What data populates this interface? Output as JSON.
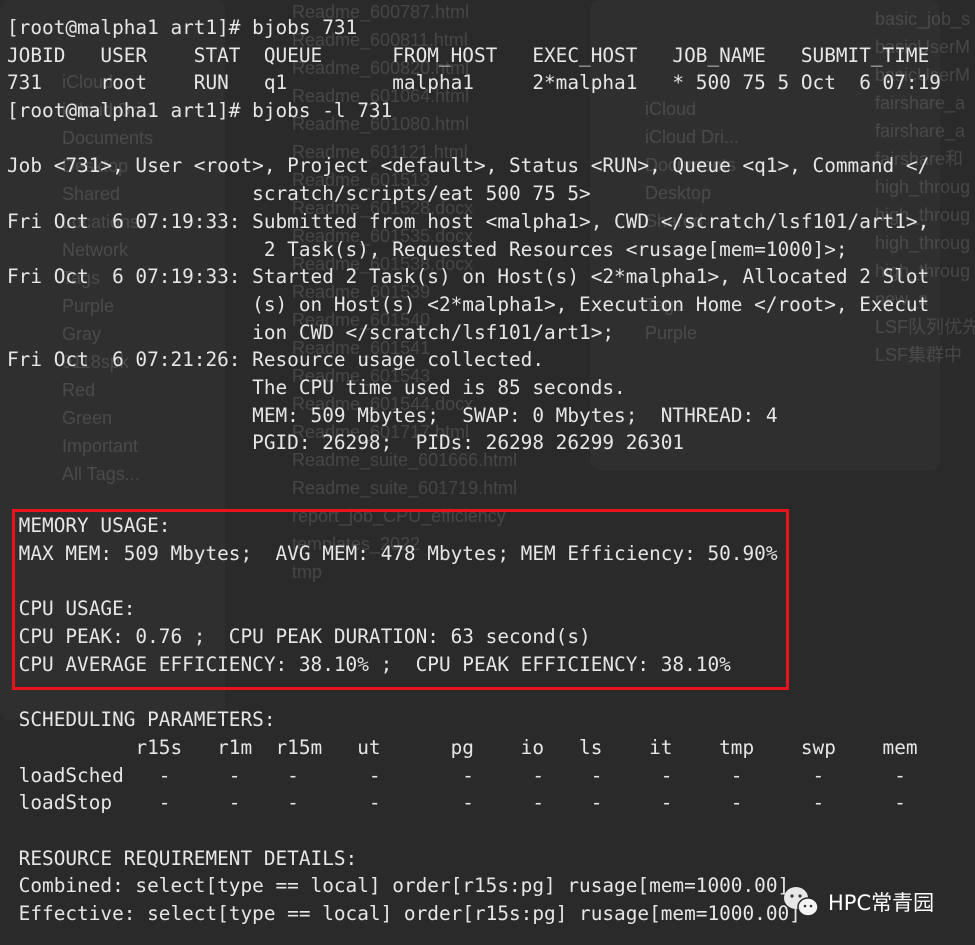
{
  "background": {
    "sidebar_items": [
      "iCloud",
      "iCloud Dri...",
      "Documents",
      "Desktop",
      "Shared",
      "Locations",
      "Network",
      "Tags",
      "Purple",
      "Gray",
      "9118spk",
      "Red",
      "Green",
      "Important",
      "All Tags..."
    ],
    "icloud_items": [
      "iCloud",
      "iCloud Dri...",
      "Documents",
      "Desktop",
      "Shared",
      "",
      "",
      "Tags",
      "Purple"
    ],
    "files_middle": [
      "Readme_600787.html",
      "Readme_600811.html",
      "Readme_600820.html",
      "Readme_601064.html",
      "Readme_601080.html",
      "Readme_601121.html",
      "Readme_601513",
      "Readme_601528.docx",
      "Readme_601535.docx",
      "Readme_601538.docx",
      "Readme_601539",
      "Readme_601540",
      "Readme_601541",
      "Readme_601543",
      "Readme_601544.docx",
      "Readme_601717.html",
      "Readme_suite_601666.html",
      "Readme_suite_601719.html",
      "report_job_CPU_efficiency",
      "templates_2022",
      "tmp"
    ],
    "files_right": [
      "basic_job_s",
      "basicUserM",
      "basicUserM",
      "fairshare_a",
      "fairshare_a",
      "fairshare和",
      "high_throug",
      "high_throug",
      "high_throug",
      "high_throug",
      "new_a",
      "LSF队列优先",
      "LSF集群中"
    ]
  },
  "terminal": {
    "lines": [
      "[root@malpha1 art1]# bjobs 731",
      "JOBID   USER    STAT  QUEUE      FROM_HOST   EXEC_HOST   JOB_NAME   SUBMIT_TIME",
      "731     root    RUN   q1         malpha1     2*malpha1   * 500 75 5 Oct  6 07:19",
      "[root@malpha1 art1]# bjobs -l 731",
      "",
      "Job <731>, User <root>, Project <default>, Status <RUN>, Queue <q1>, Command </",
      "                     scratch/scripts/eat 500 75 5>",
      "Fri Oct  6 07:19:33: Submitted from host <malpha1>, CWD </scratch/lsf101/art1>,",
      "                      2 Task(s), Requested Resources <rusage[mem=1000]>;",
      "Fri Oct  6 07:19:33: Started 2 Task(s) on Host(s) <2*malpha1>, Allocated 2 Slot",
      "                     (s) on Host(s) <2*malpha1>, Execution Home </root>, Execut",
      "                     ion CWD </scratch/lsf101/art1>;",
      "Fri Oct  6 07:21:26: Resource usage collected.",
      "                     The CPU time used is 85 seconds.",
      "                     MEM: 509 Mbytes;  SWAP: 0 Mbytes;  NTHREAD: 4",
      "                     PGID: 26298;  PIDs: 26298 26299 26301",
      "",
      "",
      " MEMORY USAGE:",
      " MAX MEM: 509 Mbytes;  AVG MEM: 478 Mbytes; MEM Efficiency: 50.90%",
      "",
      " CPU USAGE:",
      " CPU PEAK: 0.76 ;  CPU PEAK DURATION: 63 second(s)",
      " CPU AVERAGE EFFICIENCY: 38.10% ;  CPU PEAK EFFICIENCY: 38.10%",
      "",
      " SCHEDULING PARAMETERS:",
      "           r15s   r1m  r15m   ut      pg    io   ls    it    tmp    swp    mem",
      " loadSched   -     -    -      -       -     -    -     -     -      -      -",
      " loadStop    -     -    -      -       -     -    -     -     -      -      -",
      "",
      " RESOURCE REQUIREMENT DETAILS:",
      " Combined: select[type == local] order[r15s:pg] rusage[mem=1000.00]",
      " Effective: select[type == local] order[r15s:pg] rusage[mem=1000.00]"
    ]
  },
  "highlight_color": "#e8141c",
  "watermark": {
    "text": "HPC常青园",
    "icon": "wechat-icon"
  }
}
